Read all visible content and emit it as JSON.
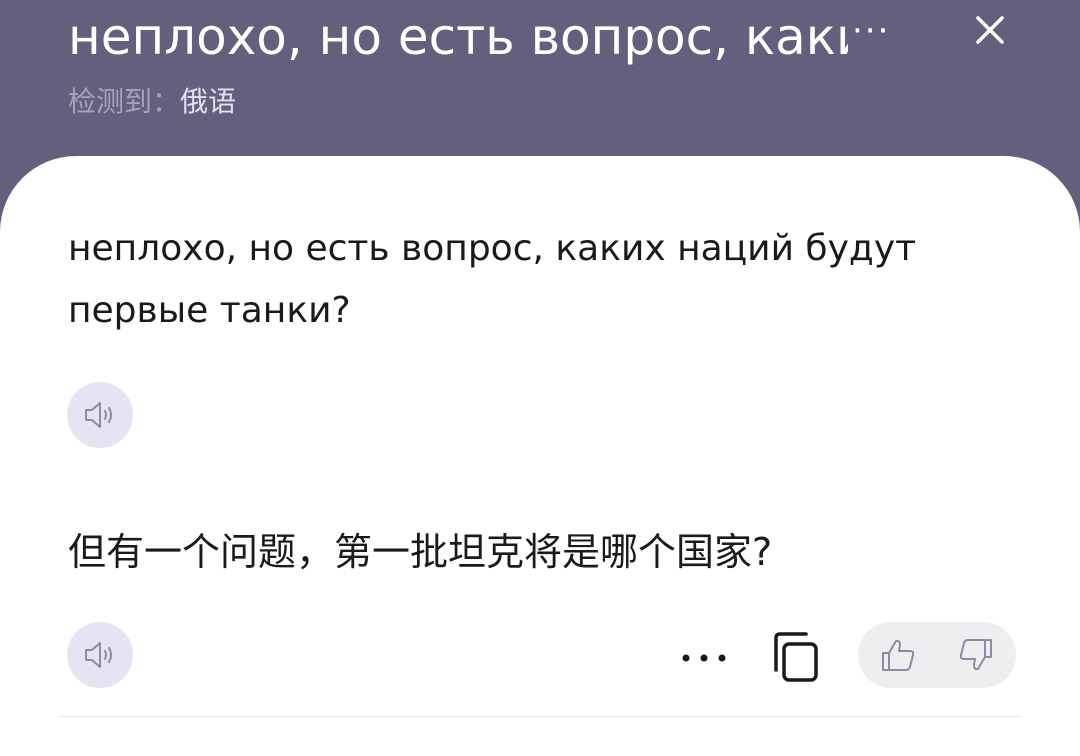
{
  "header": {
    "title": "неплохо, но есть вопрос, каких наций будут первые танки?",
    "ellipsis": "···",
    "detected_label": "检测到：",
    "detected_language": "俄语"
  },
  "source": {
    "text": "неплохо, но есть вопрос, каких наций будут первые танки?"
  },
  "translation": {
    "text": "但有一个问题，第一批坦克将是哪个国家?"
  },
  "icons": {
    "close": "close-icon",
    "speaker": "speaker-icon",
    "more": "more-icon",
    "copy": "copy-icon",
    "thumb_up": "thumb-up-icon",
    "thumb_down": "thumb-down-icon"
  },
  "colors": {
    "header_bg": "#665e7d",
    "card_bg": "#ffffff",
    "speaker_bg": "#e6e4f2",
    "icon_stroke": "#8e8aa6",
    "pill_bg": "#eeeef1"
  }
}
